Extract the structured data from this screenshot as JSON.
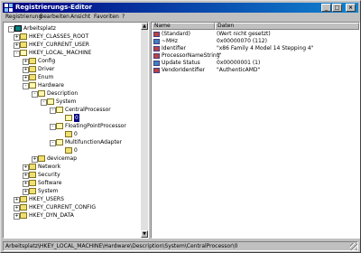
{
  "window": {
    "title": "Registrierungs-Editor"
  },
  "titlebar": {
    "min_glyph": "_",
    "max_glyph": "□",
    "close_glyph": "×"
  },
  "menu": [
    "Registrierung",
    "Bearbeiten",
    "Ansicht",
    "Favoriten",
    "?"
  ],
  "tree": [
    {
      "label": "Arbeitsplatz",
      "exp": "-",
      "icon": "computer"
    },
    {
      "label": "HKEY_CLASSES_ROOT",
      "exp": "+",
      "icon": "folder"
    },
    {
      "label": "HKEY_CURRENT_USER",
      "exp": "+",
      "icon": "folder"
    },
    {
      "label": "HKEY_LOCAL_MACHINE",
      "exp": "-",
      "icon": "folder-open"
    },
    {
      "label": "Config",
      "exp": "+",
      "icon": "folder"
    },
    {
      "label": "Driver",
      "exp": "+",
      "icon": "folder"
    },
    {
      "label": "Enum",
      "exp": "+",
      "icon": "folder"
    },
    {
      "label": "Hardware",
      "exp": "-",
      "icon": "folder-open"
    },
    {
      "label": "Description",
      "exp": "-",
      "icon": "folder-open"
    },
    {
      "label": "System",
      "exp": "-",
      "icon": "folder-open"
    },
    {
      "label": "CentralProcessor",
      "exp": "-",
      "icon": "folder-open"
    },
    {
      "label": "0",
      "exp": "",
      "icon": "folder-open",
      "selected": true
    },
    {
      "label": "FloatingPointProcessor",
      "exp": "-",
      "icon": "folder-open"
    },
    {
      "label": "0",
      "exp": "",
      "icon": "folder"
    },
    {
      "label": "MultifunctionAdapter",
      "exp": "-",
      "icon": "folder-open"
    },
    {
      "label": "0",
      "exp": "",
      "icon": "folder"
    },
    {
      "label": "devicemap",
      "exp": "+",
      "icon": "folder"
    },
    {
      "label": "Network",
      "exp": "+",
      "icon": "folder"
    },
    {
      "label": "Security",
      "exp": "+",
      "icon": "folder"
    },
    {
      "label": "Software",
      "exp": "+",
      "icon": "folder"
    },
    {
      "label": "System",
      "exp": "+",
      "icon": "folder"
    },
    {
      "label": "HKEY_USERS",
      "exp": "+",
      "icon": "folder"
    },
    {
      "label": "HKEY_CURRENT_CONFIG",
      "exp": "+",
      "icon": "folder"
    },
    {
      "label": "HKEY_DYN_DATA",
      "exp": "+",
      "icon": "folder"
    }
  ],
  "list": {
    "headers": [
      "Name",
      "Daten"
    ],
    "rows": [
      {
        "name": "(Standard)",
        "data": "(Wert nicht gesetzt)",
        "type": "string"
      },
      {
        "name": "~MHz",
        "data": "0x00000070 (112)",
        "type": "binary"
      },
      {
        "name": "Identifier",
        "data": "\"x86 Family 4 Model 14 Stepping 4\"",
        "type": "string"
      },
      {
        "name": "ProcessorNameString",
        "data": "\"\"",
        "type": "string"
      },
      {
        "name": "Update Status",
        "data": "0x00000001 (1)",
        "type": "binary"
      },
      {
        "name": "VendorIdentifier",
        "data": "\"AuthenticAMD\"",
        "type": "string"
      }
    ]
  },
  "status": "Arbeitsplatz\\HKEY_LOCAL_MACHINE\\Hardware\\Description\\System\\CentralProcessor\\0"
}
